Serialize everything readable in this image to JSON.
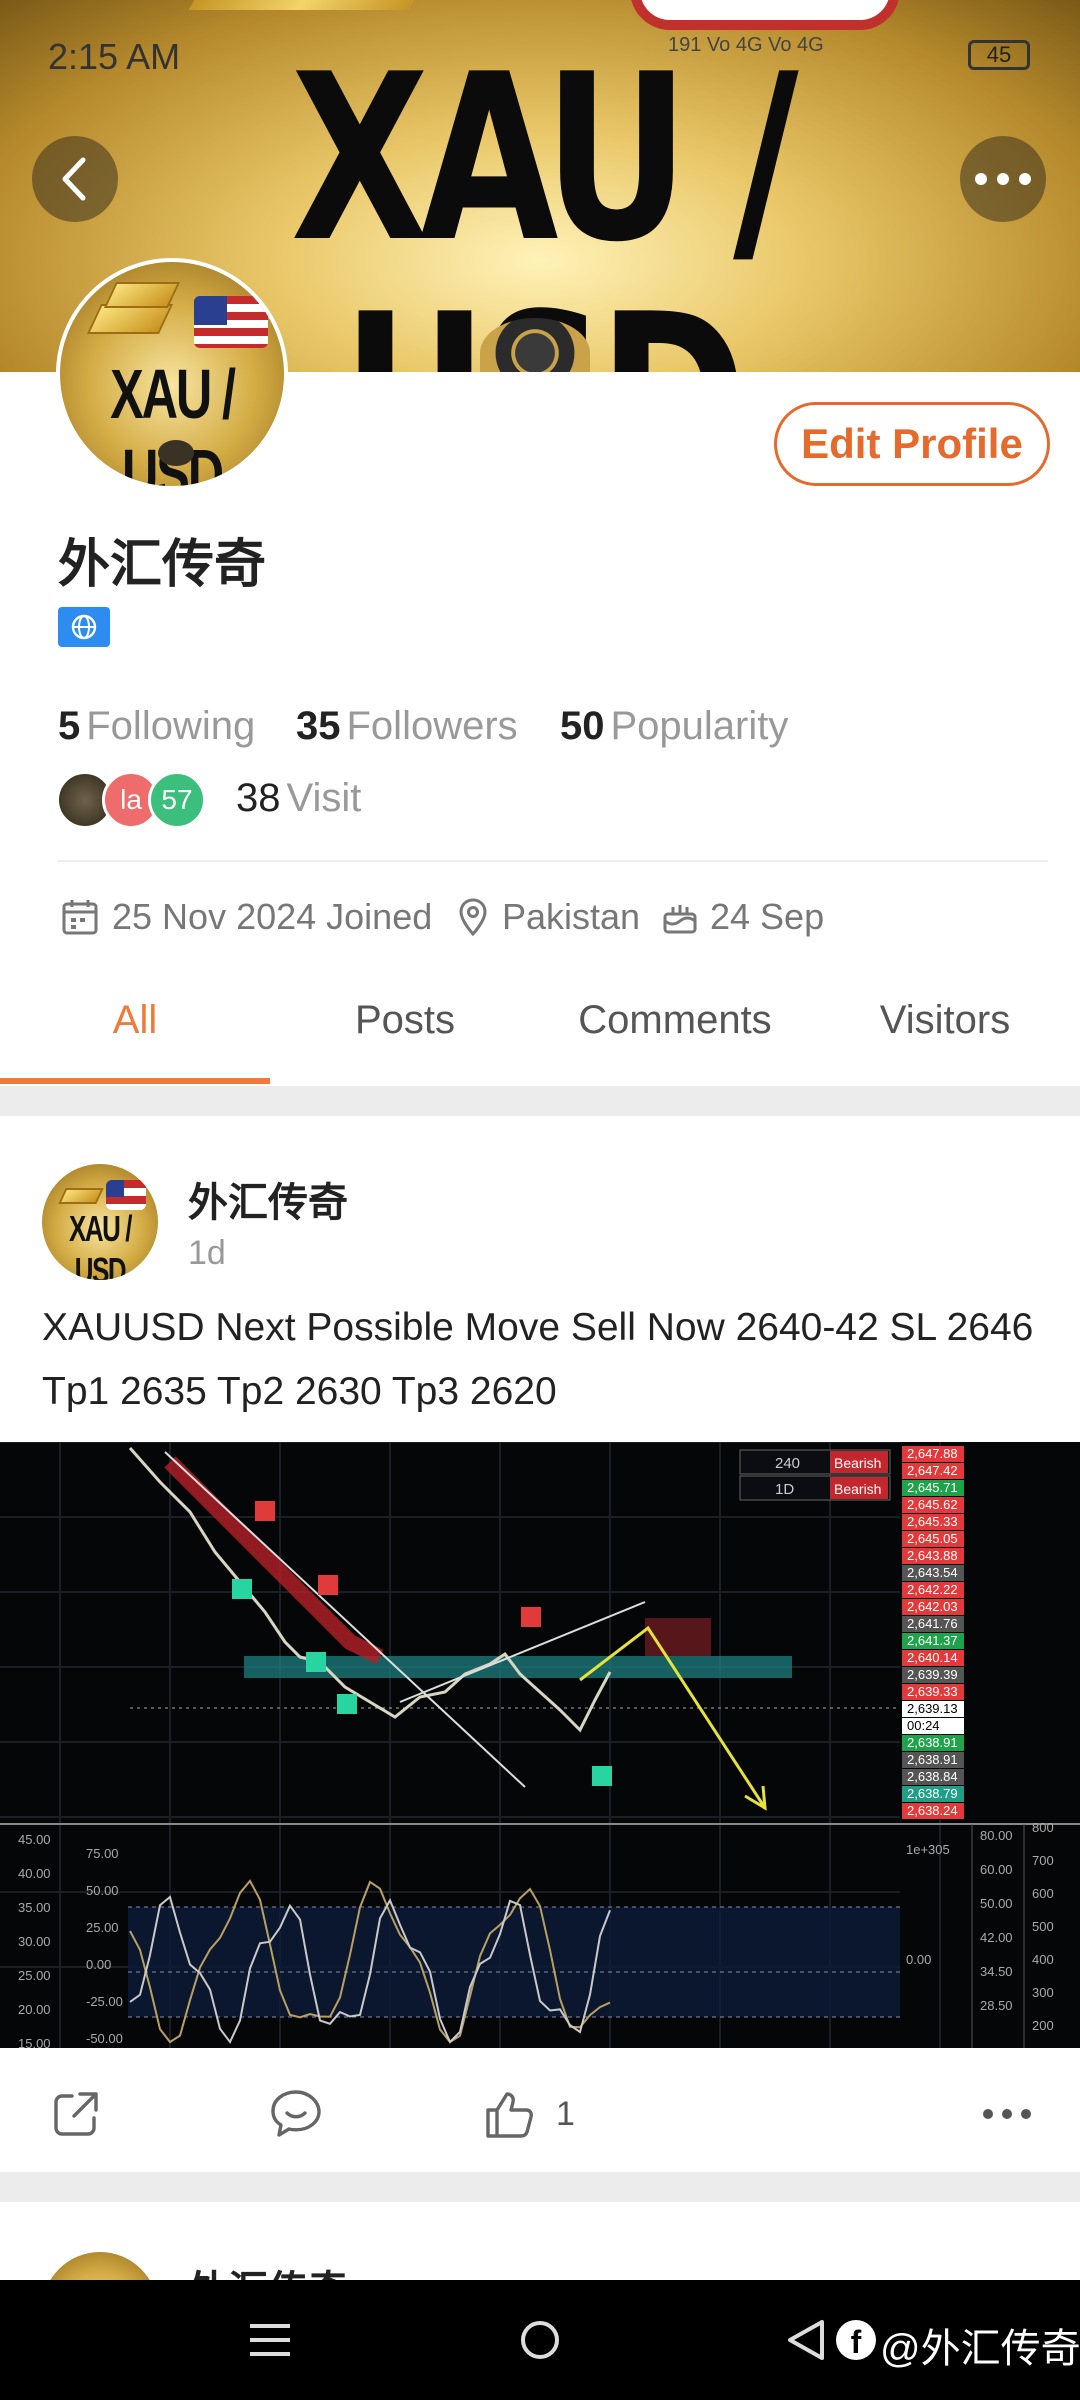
{
  "status_bar": {
    "time": "2:15 AM",
    "signal_text": "191 Vo 4G Vo 4G",
    "battery": "45"
  },
  "banner": {
    "title": "XAU / USD"
  },
  "avatar": {
    "text": "XAU / USD"
  },
  "profile": {
    "edit_label": "Edit Profile",
    "name": "外汇传奇",
    "following_count": "5",
    "following_label": "Following",
    "followers_count": "35",
    "followers_label": "Followers",
    "popularity_count": "50",
    "popularity_label": "Popularity",
    "visitor_avatars": [
      "",
      "la",
      "57"
    ],
    "visit_count": "38",
    "visit_label": "Visit",
    "joined": "25 Nov 2024 Joined",
    "location": "Pakistan",
    "birthday": "24 Sep"
  },
  "tabs": [
    {
      "label": "All",
      "active": true
    },
    {
      "label": "Posts"
    },
    {
      "label": "Comments"
    },
    {
      "label": "Visitors"
    }
  ],
  "post": {
    "author": "外汇传奇",
    "time": "1d",
    "text": "XAUUSD Next Possible Move Sell Now 2640-42 SL 2646 Tp1 2635 Tp2 2630 Tp3 2620",
    "like_count": "1"
  },
  "chart_data": {
    "type": "line",
    "title": "",
    "table": [
      {
        "tf": "240",
        "signal": "Bearish"
      },
      {
        "tf": "1D",
        "signal": "Bearish"
      }
    ],
    "price_scale": [
      "2,647.88",
      "2,647.42",
      "2,645.71",
      "2,645.62",
      "2,645.33",
      "2,645.05",
      "2,643.88",
      "2,643.54",
      "2,642.22",
      "2,642.03",
      "2,641.76",
      "2,641.37",
      "2,640.14",
      "2,639.39",
      "2,639.33",
      "2,639.13",
      "00:24",
      "2,638.91",
      "2,638.91",
      "2,638.84",
      "2,638.79",
      "2,638.24"
    ],
    "osc_left_scale": [
      "45.00",
      "40.00",
      "35.00",
      "30.00",
      "25.00",
      "20.00",
      "15.00"
    ],
    "osc_inner_scale": [
      "75.00",
      "50.00",
      "25.00",
      "0.00",
      "-25.00",
      "-50.00"
    ],
    "osc_right_scale_a": [
      "1e+305",
      "0.00"
    ],
    "osc_right_scale_b": [
      "80.00",
      "60.00",
      "50.00",
      "42.00",
      "34.50",
      "28.50"
    ],
    "osc_right_scale_c": [
      "800",
      "700",
      "600",
      "500",
      "400",
      "300",
      "200"
    ]
  },
  "next_post": {
    "author": "外汇传奇"
  },
  "nav": {
    "watermark": "@外汇传奇"
  }
}
